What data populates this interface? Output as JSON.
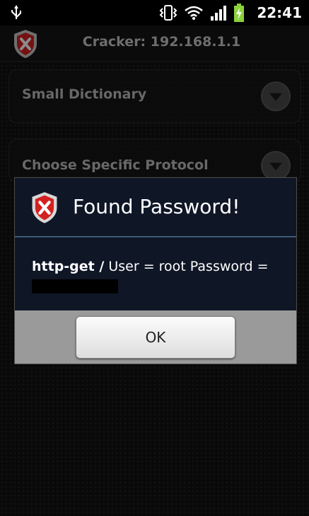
{
  "status_bar": {
    "time": "22:41",
    "icons": [
      "usb-icon",
      "vibrate-icon",
      "wifi-icon",
      "signal-icon",
      "battery-charging-icon"
    ]
  },
  "app_bar": {
    "title": "Cracker: 192.168.1.1",
    "icon": "shield-x-icon"
  },
  "panels": [
    {
      "label": "Small Dictionary",
      "icon": "chevron-down-icon"
    },
    {
      "label": "Choose Specific Protocol",
      "icon": "chevron-down-icon"
    }
  ],
  "dialog": {
    "title": "Found Password!",
    "protocol": "http-get /",
    "message": "User = root Password =",
    "ok_label": "OK"
  },
  "colors": {
    "dialog_bg": "#0f1626",
    "divider": "#3b5a74",
    "shield_red": "#d42020"
  }
}
